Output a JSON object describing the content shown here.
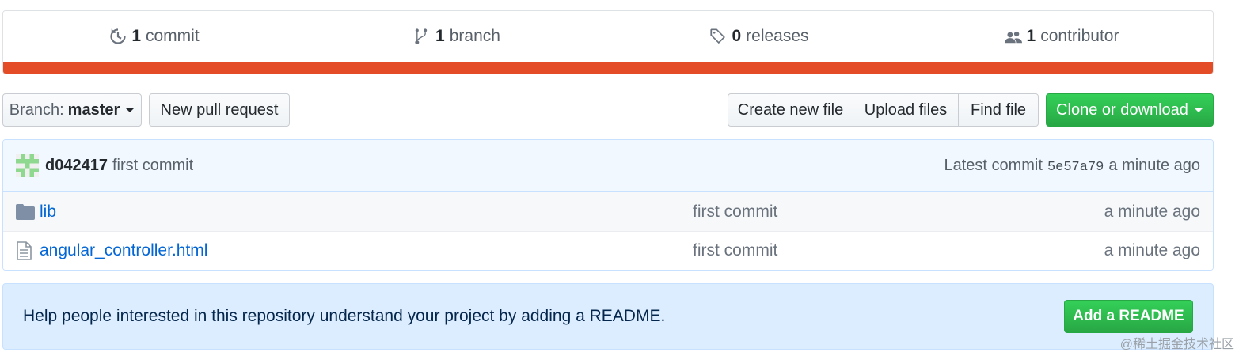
{
  "summary": {
    "commits": {
      "num": "1",
      "label": "commit"
    },
    "branches": {
      "num": "1",
      "label": "branch"
    },
    "releases": {
      "num": "0",
      "label": "releases"
    },
    "contributors": {
      "num": "1",
      "label": "contributor"
    },
    "language_color": "#e34c26"
  },
  "toolbar": {
    "branch_label": "Branch:",
    "branch_value": "master",
    "new_pull_request": "New pull request",
    "create_new_file": "Create new file",
    "upload_files": "Upload files",
    "find_file": "Find file",
    "clone_or_download": "Clone or download"
  },
  "commit": {
    "author": "d042417",
    "message": "first commit",
    "latest_label": "Latest commit",
    "sha": "5e57a79",
    "age": "a minute ago"
  },
  "files": [
    {
      "type": "folder",
      "icon": "folder-icon",
      "name": "lib",
      "message": "first commit",
      "age": "a minute ago"
    },
    {
      "type": "file",
      "icon": "file-icon",
      "name": "angular_controller.html",
      "message": "first commit",
      "age": "a minute ago"
    }
  ],
  "readme": {
    "text": "Help people interested in this repository understand your project by adding a README.",
    "button": "Add a README"
  },
  "watermark": "@稀土掘金技术社区",
  "colors": {
    "accent_green": "#28a745",
    "link_blue": "#0366d6"
  }
}
